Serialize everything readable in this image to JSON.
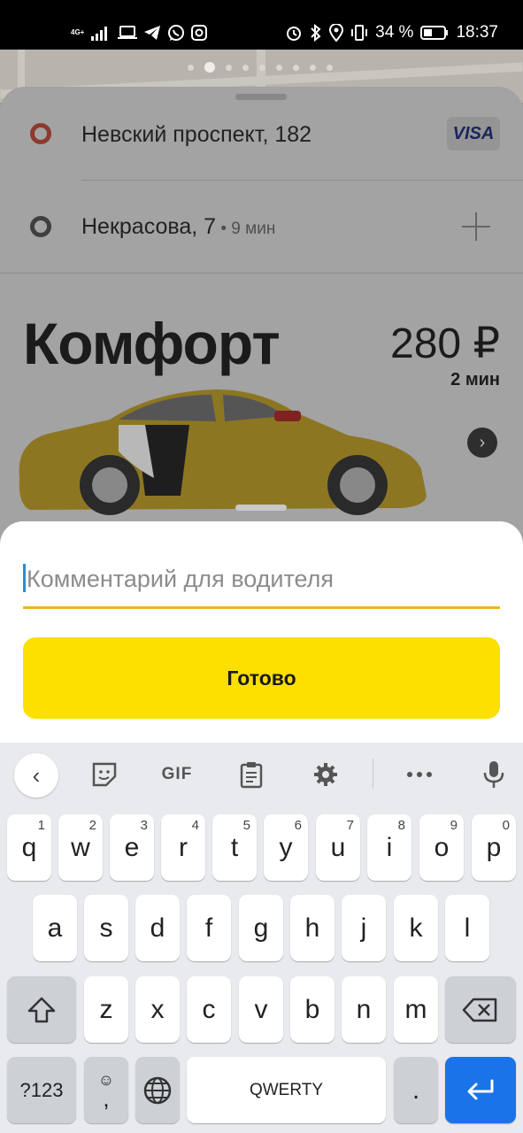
{
  "status_bar": {
    "network": "4G+",
    "battery_percent": "34 %",
    "time": "18:37",
    "left_icons": [
      "signal-icon",
      "laptop-icon",
      "telegram-icon",
      "whatsapp-icon",
      "instagram-icon"
    ],
    "right_icons": [
      "alarm-icon",
      "bluetooth-icon",
      "location-icon",
      "vibrate-icon",
      "battery-icon"
    ]
  },
  "route": {
    "from": "Невский проспект, 182",
    "to": "Некрасова, 7",
    "to_eta": " • 9 мин",
    "payment": "VISA"
  },
  "tariff": {
    "name": "Комфорт",
    "price": "280 ₽",
    "eta": "2 мин"
  },
  "comment": {
    "placeholder": "Комментарий для водителя",
    "value": "",
    "done_label": "Готово"
  },
  "keyboard": {
    "toolbar": {
      "gif_label": "GIF"
    },
    "row1": [
      {
        "k": "q",
        "hint": "1"
      },
      {
        "k": "w",
        "hint": "2"
      },
      {
        "k": "e",
        "hint": "3"
      },
      {
        "k": "r",
        "hint": "4"
      },
      {
        "k": "t",
        "hint": "5"
      },
      {
        "k": "y",
        "hint": "6"
      },
      {
        "k": "u",
        "hint": "7"
      },
      {
        "k": "i",
        "hint": "8"
      },
      {
        "k": "o",
        "hint": "9"
      },
      {
        "k": "p",
        "hint": "0"
      }
    ],
    "row2": [
      "a",
      "s",
      "d",
      "f",
      "g",
      "h",
      "j",
      "k",
      "l"
    ],
    "row3": [
      "z",
      "x",
      "c",
      "v",
      "b",
      "n",
      "m"
    ],
    "symbols_label": "?123",
    "comma_label": ",",
    "space_label": "QWERTY",
    "period_label": "."
  },
  "colors": {
    "accent_yellow": "#fce000",
    "input_underline": "#e8b61e",
    "enter_key": "#1a73e8"
  }
}
